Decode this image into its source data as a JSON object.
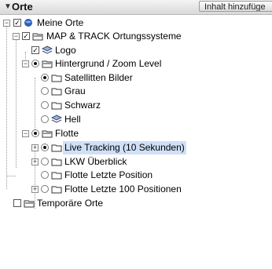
{
  "header": {
    "title": "Orte",
    "collapse_arrow": "▼",
    "add_button": "Inhalt hinzufüge"
  },
  "tree": {
    "root": "Meine Orte",
    "track": "MAP & TRACK Ortungssysteme",
    "logo": "Logo",
    "background": "Hintergrund / Zoom Level",
    "satellite": "Satellitten Bilder",
    "grau": "Grau",
    "schwarz": "Schwarz",
    "hell": "Hell",
    "flotte": "Flotte",
    "live": "Live Tracking (10 Sekunden)",
    "lkw": "LKW Überblick",
    "letzte": "Flotte Letzte Position",
    "letzte100": "Flotte Letzte 100 Positionen",
    "temp": "Temporäre Orte"
  },
  "state": {
    "expanded_symbol": "−",
    "collapsed_symbol": "+",
    "check_symbol": "✓"
  },
  "colors": {
    "selected_bg": "#cfe0f7"
  }
}
